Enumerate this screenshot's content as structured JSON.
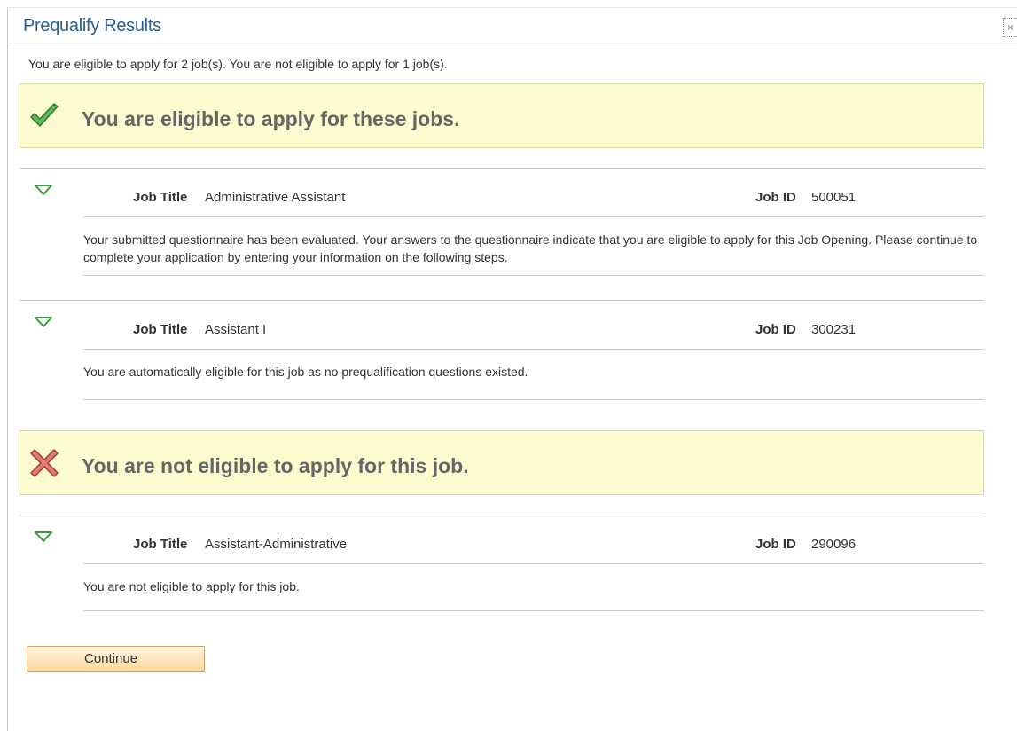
{
  "dialog": {
    "title": "Prequalify Results",
    "close_label": "×"
  },
  "summary": "You are eligible to apply for 2 job(s).  You are not eligible to apply for 1 job(s).",
  "eligible_section": {
    "banner_text": "You are eligible to apply for these jobs.",
    "icon": "checkmark-icon",
    "icon_color": "#3a9a3a",
    "jobs": [
      {
        "title_label": "Job Title",
        "title": "Administrative Assistant",
        "id_label": "Job ID",
        "id": "500051",
        "description": "Your submitted questionnaire has been evaluated. Your answers to the questionnaire indicate that you are eligible to apply for this Job Opening. Please continue to complete your application by entering your information on the following steps."
      },
      {
        "title_label": "Job Title",
        "title": "Assistant I",
        "id_label": "Job ID",
        "id": "300231",
        "description": "You are automatically eligible for this job as no prequalification questions existed."
      }
    ]
  },
  "ineligible_section": {
    "banner_text": "You are not eligible to apply for this job.",
    "icon": "x-mark-icon",
    "icon_color": "#c0504d",
    "jobs": [
      {
        "title_label": "Job Title",
        "title": "Assistant-Administrative",
        "id_label": "Job ID",
        "id": "290096",
        "description": "You are not eligible to apply for this job."
      }
    ]
  },
  "actions": {
    "continue_label": "Continue"
  },
  "colors": {
    "title_blue": "#2a5f98",
    "banner_yellow": "#fbfbcf",
    "expand_green": "#3b9c3b"
  }
}
